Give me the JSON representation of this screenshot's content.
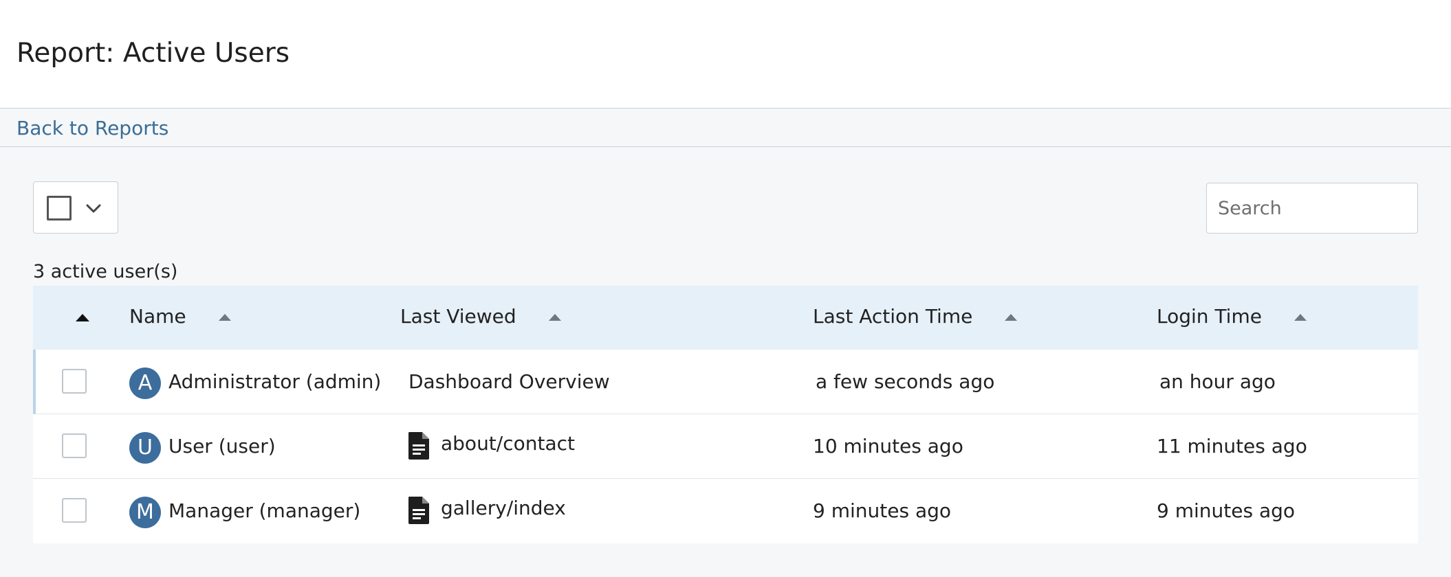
{
  "header": {
    "title": "Report: Active Users"
  },
  "nav": {
    "back_label": "Back to Reports"
  },
  "toolbar": {
    "search_placeholder": "Search",
    "search_value": ""
  },
  "summary": {
    "count_label": "3 active user(s)"
  },
  "table": {
    "columns": {
      "name": "Name",
      "last_viewed": "Last Viewed",
      "last_action_time": "Last Action Time",
      "login_time": "Login Time"
    },
    "rows": [
      {
        "avatar": "A",
        "name": "Administrator (admin)",
        "last_viewed": "Dashboard Overview",
        "last_viewed_icon": "",
        "last_action_time": "a few seconds ago",
        "login_time": "an hour ago"
      },
      {
        "avatar": "U",
        "name": "User (user)",
        "last_viewed": "about/contact",
        "last_viewed_icon": "document-icon",
        "last_action_time": "10 minutes ago",
        "login_time": "11 minutes ago"
      },
      {
        "avatar": "M",
        "name": "Manager (manager)",
        "last_viewed": "gallery/index",
        "last_viewed_icon": "document-icon",
        "last_action_time": "9 minutes ago",
        "login_time": "9 minutes ago"
      }
    ]
  },
  "colors": {
    "link": "#3a6d96",
    "avatar": "#3c6d9c",
    "table_header_bg": "#e6f0f8",
    "page_bg": "#f5f7f9"
  }
}
